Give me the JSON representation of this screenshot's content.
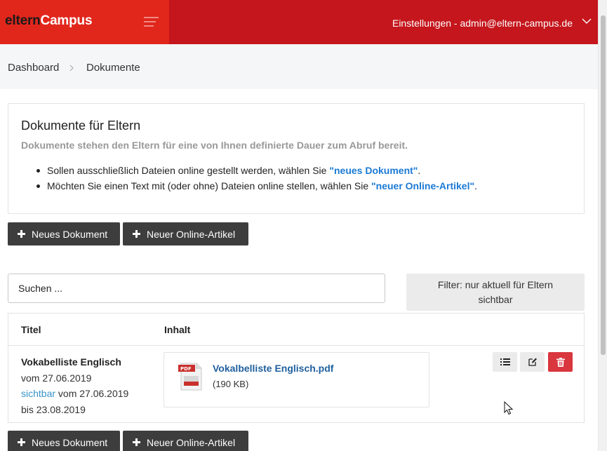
{
  "header": {
    "brand_part1": "eltern",
    "brand_part2": "Campus",
    "settings_label": "Einstellungen - admin@eltern-campus.de",
    "brand_color": "#e1261c",
    "bar_color": "#c4161c"
  },
  "breadcrumb": {
    "items": [
      "Dashboard",
      "Dokumente"
    ]
  },
  "info": {
    "title": "Dokumente für Eltern",
    "subtitle": "Dokumente stehen den Eltern für eine von Ihnen definierte Dauer zum Abruf bereit.",
    "bullets": [
      {
        "pre": "Sollen ausschließlich Dateien online gestellt werden, wählen Sie ",
        "hl": "\"neues Dokument\"",
        "post": "."
      },
      {
        "pre": "Möchten Sie einen Text mit (oder ohne) Dateien online stellen, wählen Sie ",
        "hl": "\"neuer Online-Artikel\"",
        "post": "."
      }
    ]
  },
  "actions": {
    "new_document": "Neues Dokument",
    "new_article": "Neuer Online-Artikel"
  },
  "search": {
    "placeholder": "Suchen ..."
  },
  "filter": {
    "line1": "Filter: nur aktuell für Eltern",
    "line2": "sichtbar"
  },
  "table": {
    "columns": [
      "Titel",
      "Inhalt"
    ],
    "rows": [
      {
        "title": "Vokabelliste Englisch",
        "created": "vom 27.06.2019",
        "visible_label": "sichtbar",
        "visible_from": " vom 27.06.2019",
        "visible_until": "bis 23.08.2019",
        "file_name": "Vokalbelliste Englisch.pdf",
        "file_size": "(190 KB)",
        "file_type": "PDF"
      }
    ]
  },
  "icons": {
    "menu": "hamburger-icon",
    "dropdown": "chevron-down-icon",
    "crumb_sep": "chevron-right-icon",
    "plus": "plus-icon",
    "list": "list-icon",
    "edit": "edit-icon",
    "delete": "trash-icon",
    "file": "pdf-file-icon"
  }
}
